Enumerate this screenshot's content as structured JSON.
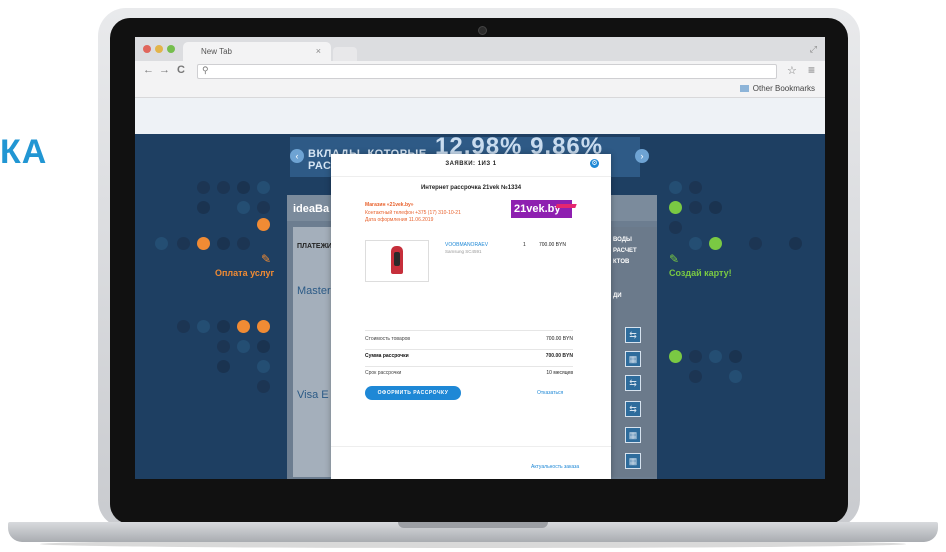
{
  "side_text": "КА",
  "browser": {
    "tab_title": "New Tab",
    "tab_close": "×",
    "address_value": "",
    "search_icon": "search-icon",
    "bookmarks_label": "Other Bookmarks",
    "nav_back": "←",
    "nav_forward": "→",
    "nav_reload": "C",
    "star_glyph": "☆",
    "menu_glyph": "≡"
  },
  "page": {
    "banner_text_line1": "ВКЛАДЫ, КОТОРЫЕ",
    "banner_text_line2": "РАСТ",
    "banner_rate": "12,98%  9,86%",
    "logo": "ideaBa",
    "left_title": "Оплата услуг",
    "right_title": "Создай карту!",
    "left_col_label": "ПЛАТЕЖИ",
    "master_label": "Master",
    "visa_label": "Visa E",
    "right_col_labels": [
      "ВОДЫ",
      "РАСЧЕТ",
      "КТОВ",
      "ДИ"
    ]
  },
  "modal": {
    "title": "ЗАЯВКИ: 1ИЗ 1",
    "subtitle": "Интернет рассрочка 21vek №1334",
    "shop": "Магазин «21vek.by»",
    "phone": "Контактный телефон +375 (17) 310-10-21",
    "date": "Дата оформления 11.06.2019",
    "partner_logo": "21vek.by",
    "product_name": "VOOBMANORAEV",
    "product_code": "Samsung SC4591",
    "qty": "1",
    "price": "700.00 BYN",
    "rows": [
      {
        "label": "Стоимость товаров",
        "value": "700.00 BYN"
      },
      {
        "label": "Сумма рассрочки",
        "value": "700.00 BYN"
      },
      {
        "label": "Срок рассрочки",
        "value": "10 месяцев"
      }
    ],
    "button_label": "ОФОРМИТЬ РАССРОЧКУ",
    "cancel_label": "Отказаться",
    "footer_link": "Актуальность заказа"
  },
  "colors": {
    "accent": "#1e88d6",
    "orange": "#f08b34",
    "green": "#7ac943",
    "partner_purple": "#8e1fb0"
  }
}
